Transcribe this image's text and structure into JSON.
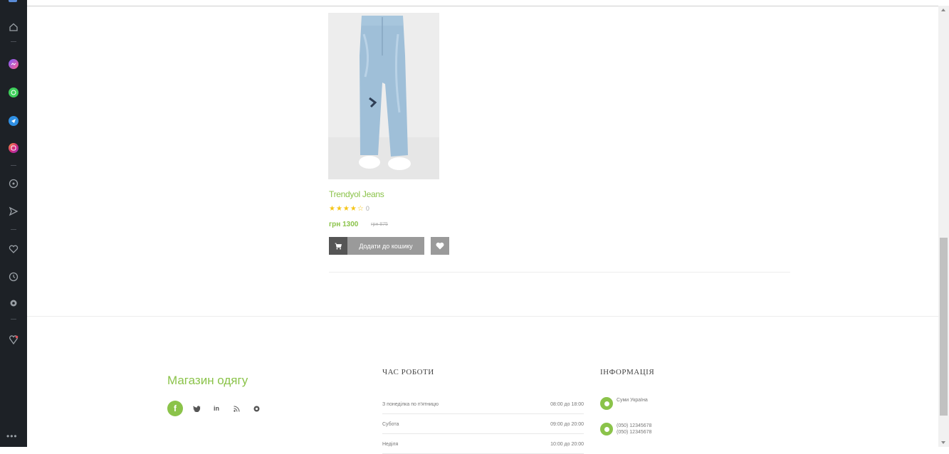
{
  "product": {
    "name": "Trendyol Jeans",
    "rating_count": "0",
    "price": "грн 1300",
    "old_price": "грн 875",
    "cart_label": "Додати до кошику"
  },
  "footer": {
    "shop_title": "Магазин одягу",
    "hours_heading": "ЧАС РОБОТИ",
    "info_heading": "ІНФОРМАЦІЯ",
    "hours": [
      {
        "day": "З понеділка по п'ятницю",
        "time": "08:00 до 18:00"
      },
      {
        "day": "Субота",
        "time": "09:00 до 20:00"
      },
      {
        "day": "Неділя",
        "time": "10:00 до 20:00"
      }
    ],
    "info": {
      "location": "Суми Україна",
      "phone_1": "(050) 12345678",
      "phone_2": "(050) 12345678"
    }
  },
  "colors": {
    "accent": "#8bc34a",
    "sidebar_bg": "#1d2126",
    "button_gray": "#9a9a9a"
  }
}
